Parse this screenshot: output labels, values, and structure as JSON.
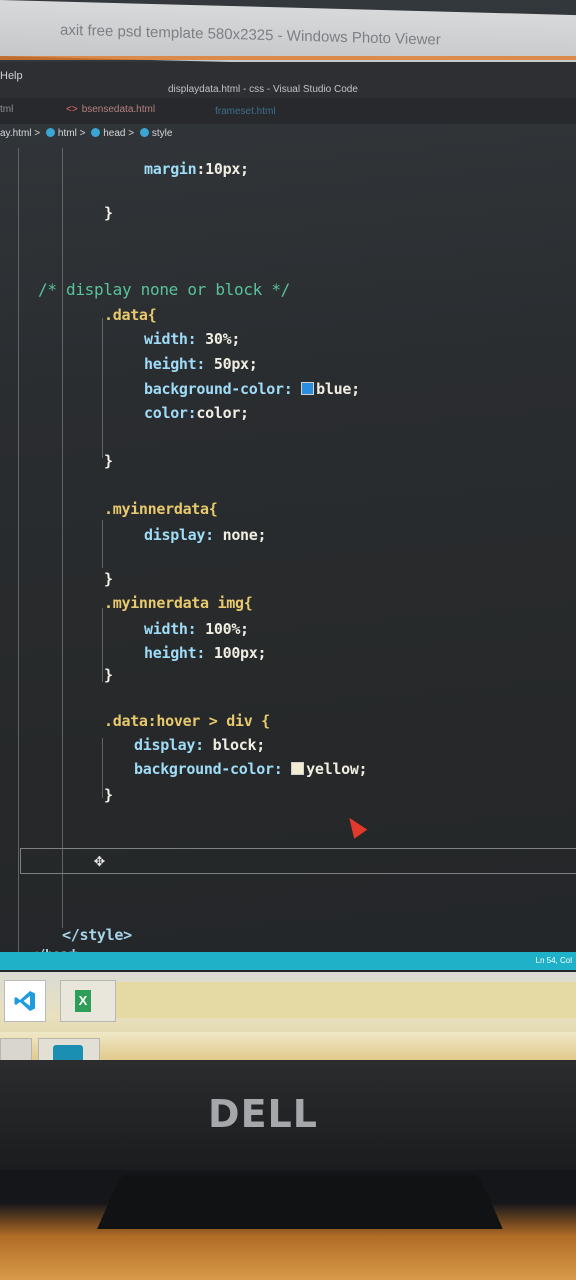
{
  "window": {
    "photo_viewer_title": "axit free psd template 580x2325 - Windows Photo Viewer",
    "vs_menu_item": "Help",
    "vs_title": "displaydata.html - css - Visual Studio Code"
  },
  "tabs": [
    {
      "label": "tml"
    },
    {
      "label": "bsensedata.html"
    },
    {
      "label": "frameset.html"
    }
  ],
  "breadcrumb": {
    "file": "ay.html",
    "sep": ">",
    "items": [
      "html",
      "head",
      "style"
    ]
  },
  "code": {
    "line1": {
      "prop": "margin",
      "sep": ":",
      "val": "10px;"
    },
    "line2": "}",
    "comment": "/* display none or block */",
    "data_selector": ".data{",
    "data_props": [
      {
        "prop": "width:",
        "val": "30%;"
      },
      {
        "prop": "height:",
        "val": "50px;"
      },
      {
        "prop": "background-color:",
        "val": "blue;"
      },
      {
        "prop": "color:",
        "val": "color;"
      }
    ],
    "data_close": "}",
    "myinner_selector": ".myinnerdata{",
    "myinner_props": [
      {
        "prop": "display:",
        "val": "none;"
      }
    ],
    "myinner_close": "}",
    "myinnerimg_selector": ".myinnerdata img{",
    "myinnerimg_props": [
      {
        "prop": "width:",
        "val": "100%;"
      },
      {
        "prop": "height:",
        "val": "100px;"
      }
    ],
    "myinnerimg_close": "}",
    "hover_selector": ".data:hover > div {",
    "hover_props": [
      {
        "prop": "display:",
        "val": "block;"
      },
      {
        "prop": "background-color:",
        "val": "yellow;"
      }
    ],
    "hover_close": "}",
    "style_close": "</style>",
    "head_close": "</head>"
  },
  "colors": {
    "blue_swatch": "#2a8de0",
    "yellow_swatch": "#f2ecd0",
    "statusbar": "#1fb1c7"
  },
  "statusbar": {
    "right_text": "Ln 54, Col"
  },
  "monitor": {
    "brand": "DELL"
  },
  "icons": [
    "vscode-icon",
    "excel-icon",
    "move-icon",
    "mouse-cursor-icon",
    "html-tag-icon"
  ]
}
